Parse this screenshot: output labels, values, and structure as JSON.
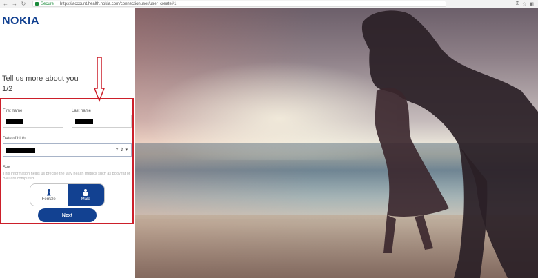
{
  "browser": {
    "secure_label": "Secure",
    "url": "https://account.health.nokia.com/connectionuser/user_create#1"
  },
  "brand": {
    "logo_text": "NOKIA",
    "color": "#124191"
  },
  "form": {
    "title": "Tell us more about you",
    "step": "1/2",
    "first_name_label": "First name",
    "last_name_label": "Last name",
    "dob_label": "Date of birth",
    "dob_controls": "× ⇕ ▾",
    "sex_label": "Sex",
    "sex_info": "This information helps us precise the way health metrics such as body fat or BMI are computed.",
    "female_label": "Female",
    "male_label": "Male",
    "selected_sex": "Male",
    "next_label": "Next"
  },
  "icons": [
    "back-icon",
    "forward-icon",
    "reload-icon",
    "lock-icon",
    "key-icon",
    "star-icon",
    "extension-icon",
    "arrow-down-annotation-icon",
    "female-icon",
    "male-icon"
  ],
  "colors": {
    "highlight_border": "#cc1f2a",
    "primary": "#124191"
  }
}
